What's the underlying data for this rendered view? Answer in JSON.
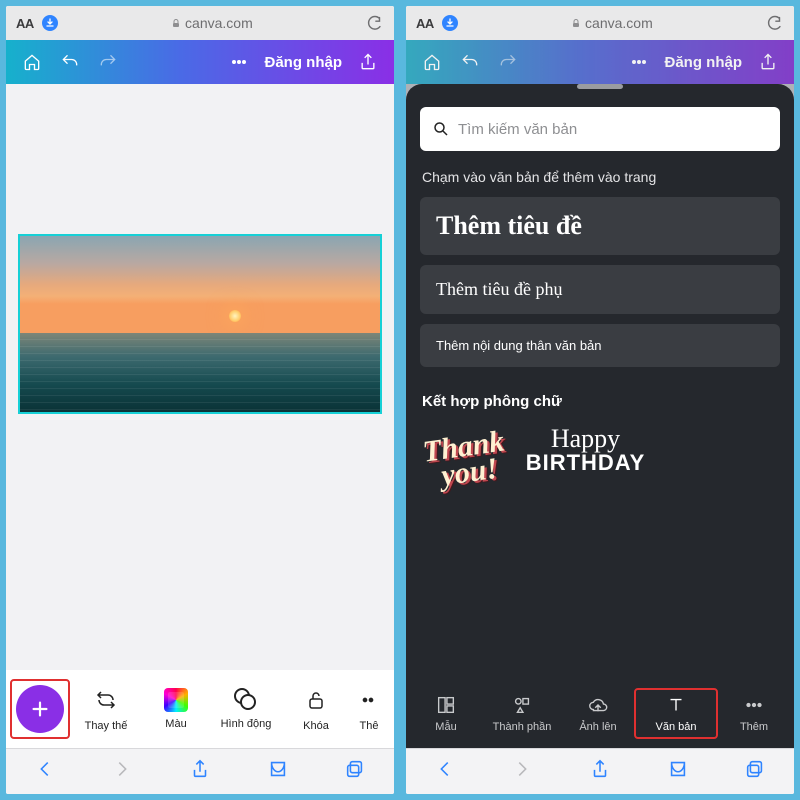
{
  "safari": {
    "url": "canva.com"
  },
  "header": {
    "login": "Đăng nhập"
  },
  "left_toolbar": {
    "replace": "Thay thế",
    "color": "Màu",
    "animate": "Hình động",
    "lock": "Khóa",
    "more": "Thê"
  },
  "text_panel": {
    "search_placeholder": "Tìm kiếm văn bản",
    "tap_hint": "Chạm vào văn bản để thêm vào trang",
    "add_heading": "Thêm tiêu đề",
    "add_subheading": "Thêm tiêu đề phụ",
    "add_body": "Thêm nội dung thân văn bản",
    "font_combos": "Kết hợp phông chữ",
    "combo_thank_1": "Thank",
    "combo_thank_2": "you!",
    "combo_hb_1": "Happy",
    "combo_hb_2": "BIRTHDAY"
  },
  "dark_toolbar": {
    "templates": "Mẫu",
    "elements": "Thành phần",
    "uploads": "Ảnh lên",
    "text": "Văn bản",
    "more": "Thêm"
  }
}
